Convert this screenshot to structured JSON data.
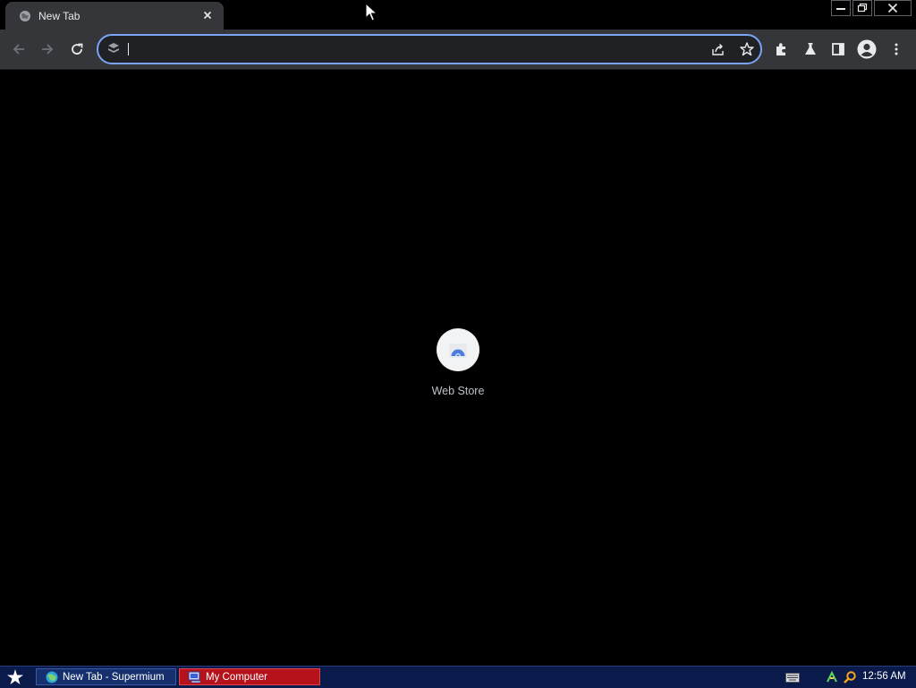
{
  "browser": {
    "tab": {
      "title": "New Tab"
    },
    "omnibox": {
      "value": "",
      "placeholder": ""
    }
  },
  "content": {
    "shortcuts": [
      {
        "label": "Web Store",
        "icon": "web-store-icon"
      }
    ]
  },
  "taskbar": {
    "items": [
      {
        "label": "New Tab - Supermium",
        "icon": "browser-icon"
      },
      {
        "label": "My Computer",
        "icon": "computer-icon"
      }
    ],
    "clock": "12:56 AM"
  },
  "colors": {
    "tab_bg": "#35363a",
    "toolbar_bg": "#35363a",
    "omnibox_border": "#7ba4f5",
    "content_bg": "#000000",
    "taskbar_bg": "#0a1a4a",
    "task_active_bg": "#b5121b"
  }
}
